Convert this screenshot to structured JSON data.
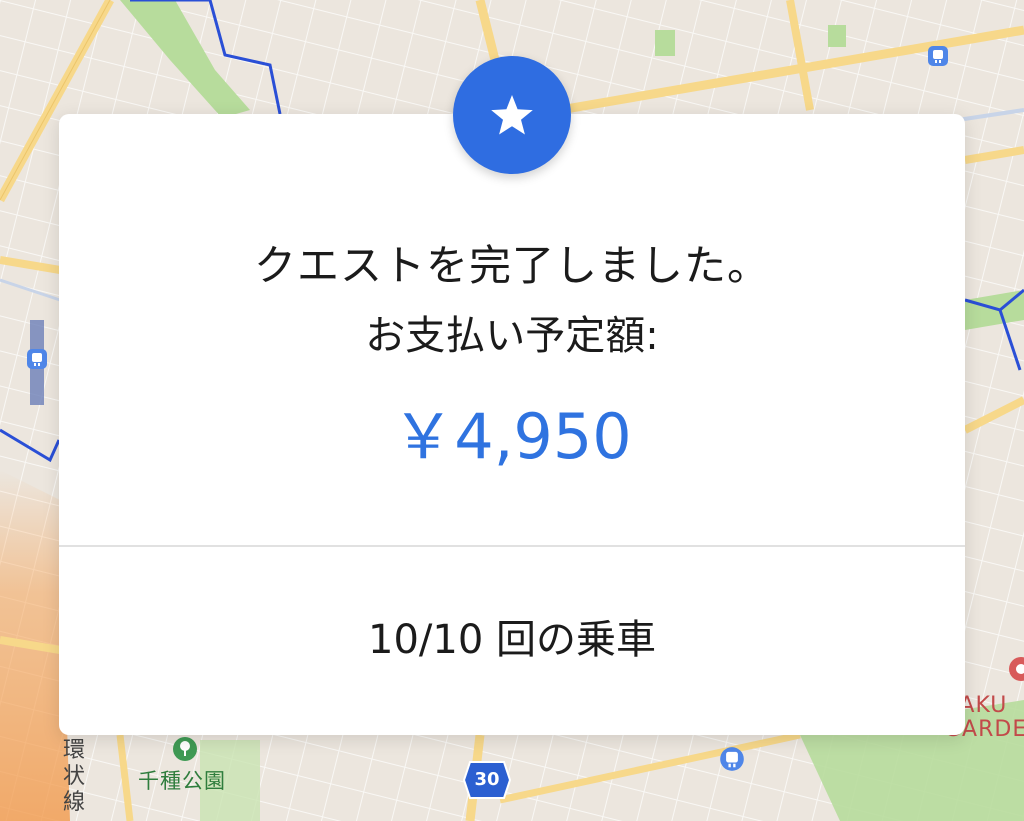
{
  "modal": {
    "title": "クエストを完了しました。",
    "subtitle": "お支払い予定額:",
    "amount": "￥4,950",
    "rides": "10/10 回の乗車",
    "badge_icon": "star-icon"
  },
  "map": {
    "park_label": "千種公園",
    "ring_line_label": "環状線",
    "route_number": "30",
    "garden_label_line1": "RAKU",
    "garden_label_line2": "GARDE"
  },
  "colors": {
    "accent": "#2f6de1",
    "amount": "#2f73e0",
    "card": "#ffffff",
    "map_base": "#efeae3",
    "road_major": "#f7d88a",
    "park_green": "#b7dc9c",
    "boundary_blue": "#2a4fd6",
    "traffic_orange": "#f5a55a"
  }
}
